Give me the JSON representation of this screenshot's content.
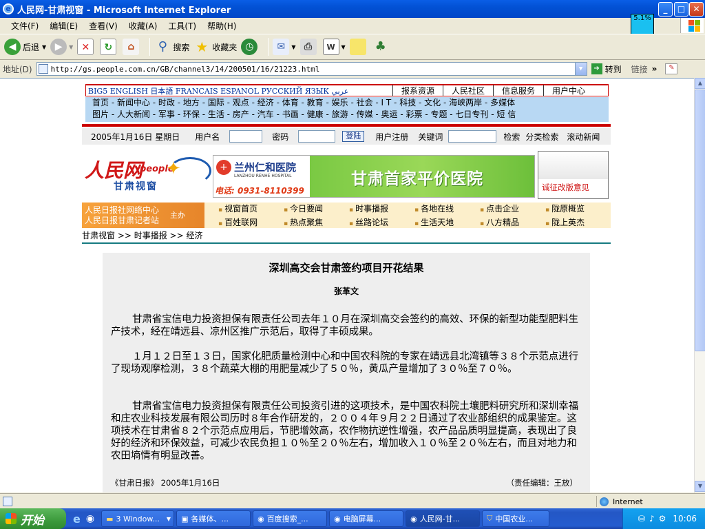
{
  "window": {
    "title": "人民网-甘肃视窗 - Microsoft Internet Explorer",
    "controls": {
      "minimize": "_",
      "maximize": "□",
      "close": "✕"
    }
  },
  "menu": [
    "文件(F)",
    "编辑(E)",
    "查看(V)",
    "收藏(A)",
    "工具(T)",
    "帮助(H)"
  ],
  "tray_widget": "5.1%",
  "toolbar": {
    "back": "后退",
    "search": "搜索",
    "favorites": "收藏夹"
  },
  "address": {
    "label": "地址(D)",
    "url": "http://gs.people.com.cn/GB/channel3/14/200501/16/21223.html",
    "go": "转到",
    "links": "链接"
  },
  "site": {
    "languages": "BIG5 ENGLISH 日本語 FRANCAIS ESPANOL РУССКИЙ ЯЗЫК عربي",
    "top_links": [
      "报系资源",
      "人民社区",
      "信息服务",
      "用户中心"
    ],
    "nav_row1": "首页 - 新闻中心 - 时政 - 地方 - 国际 - 观点 - 经济 - 体育 - 教育 - 娱乐 - 社会 - I T - 科技 - 文化 - 海峡两岸 - 多媒体",
    "nav_row2": "图片 - 人大新闻 - 军事 - 环保 - 生活 - 房产 - 汽车 - 书画 - 健康 - 旅游 - 传媒 - 奥运 - 彩票 - 专题 - 七日专刊 - 短 信",
    "login": {
      "date": "2005年1月16日 星期日",
      "username_label": "用户名",
      "password_label": "密码",
      "login_button": "登陆",
      "register": "用户注册",
      "keyword_label": "关键词",
      "search": "检索",
      "category_search": "分类检索",
      "scroll_news": "滚动新闻"
    },
    "logo": {
      "brand": "人民网",
      "latin": "people",
      "sub": "甘肃视窗"
    },
    "banner": {
      "hospital": "兰州仁和医院",
      "hospital_en": "LANZHOU RENHE HOSPITAL",
      "phone": "电话: 0931-8110399",
      "slogan": "甘肃首家平价医院"
    },
    "side_ad": "诚征改版意见",
    "organizer": {
      "line1": "人民日报社网络中心",
      "line2": "人民日报甘肃记者站",
      "role": "主办"
    },
    "quick_links": [
      "视窗首页",
      "今日要闻",
      "时事播报",
      "各地在线",
      "点击企业",
      "陇原概览",
      "百姓联网",
      "热点聚焦",
      "丝路论坛",
      "生活天地",
      "八方精品",
      "陇上英杰"
    ],
    "breadcrumb": "甘肃视窗 >> 时事播报 >> 经济"
  },
  "article": {
    "title": "深圳高交会甘肃签约项目开花结果",
    "author": "张革文",
    "paragraphs": [
      "甘肃省宝信电力投资担保有限责任公司去年１０月在深圳高交会签约的高效、环保的新型功能型肥料生产技术，经在靖远县、凉州区推广示范后，取得了丰硕成果。",
      "１月１２日至１３日，国家化肥质量检测中心和中国农科院的专家在靖远县北湾镇等３８个示范点进行了现场观摩检测，３８个蔬菜大棚的用肥量减少了５０％，黄瓜产量增加了３０％至７０％。",
      "甘肃省宝信电力投资担保有限责任公司投资引进的这项技术，是中国农科院土壤肥料研究所和深圳幸福和庄农业科技发展有限公司历时８年合作研发的，２００４年９月２２日通过了农业部组织的成果鉴定。这项技术在甘肃省８２个示范点应用后，节肥增效高，农作物抗逆性增强，农产品品质明显提高，表现出了良好的经济和环保效益，可减少农民负担１０％至２０％左右，增加收入１０％至２０％左右，而且对地力和农田墒情有明显改善。"
    ],
    "source": "《甘肃日报》 2005年1月16日",
    "editor": "（责任编辑：王放）"
  },
  "status": {
    "zone": "Internet"
  },
  "taskbar": {
    "start": "开始",
    "tasks": [
      "3 Window...",
      "各媒体、...",
      "百度搜索_...",
      "电脑屏幕...",
      "人民网-甘...",
      "中国农业..."
    ],
    "clock": "10:06"
  }
}
